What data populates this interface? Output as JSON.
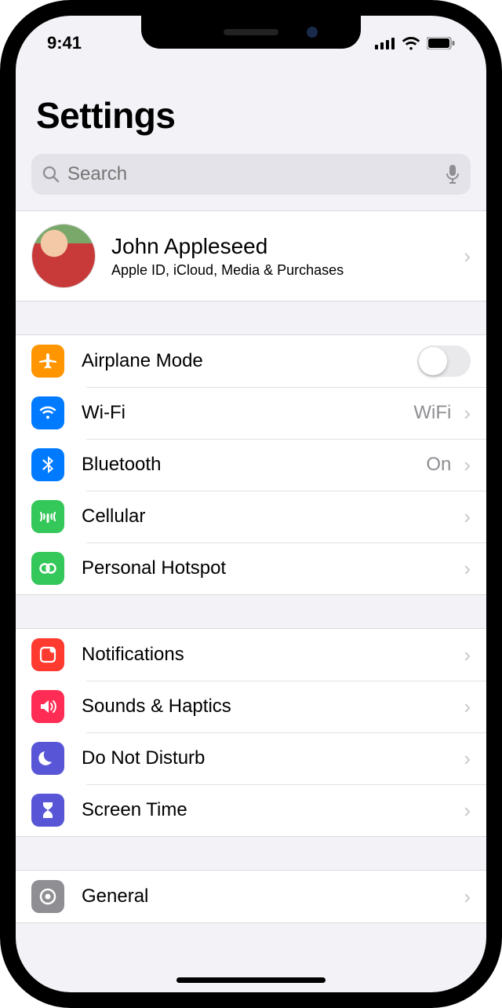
{
  "status": {
    "time": "9:41"
  },
  "header": {
    "title": "Settings"
  },
  "search": {
    "placeholder": "Search"
  },
  "profile": {
    "name": "John Appleseed",
    "subtitle": "Apple ID, iCloud, Media & Purchases"
  },
  "group1": {
    "airplane": {
      "label": "Airplane Mode",
      "on": false
    },
    "wifi": {
      "label": "Wi-Fi",
      "value": "WiFi"
    },
    "bluetooth": {
      "label": "Bluetooth",
      "value": "On"
    },
    "cellular": {
      "label": "Cellular"
    },
    "hotspot": {
      "label": "Personal Hotspot"
    }
  },
  "group2": {
    "notifications": {
      "label": "Notifications"
    },
    "sounds": {
      "label": "Sounds & Haptics"
    },
    "dnd": {
      "label": "Do Not Disturb"
    },
    "screentime": {
      "label": "Screen Time"
    }
  },
  "group3": {
    "general": {
      "label": "General"
    }
  },
  "colors": {
    "orange": "#ff9500",
    "blue": "#007aff",
    "green": "#34c759",
    "red": "#ff3b30",
    "pink": "#ff2d55",
    "purple": "#5856d6",
    "gray": "#8e8e93"
  }
}
